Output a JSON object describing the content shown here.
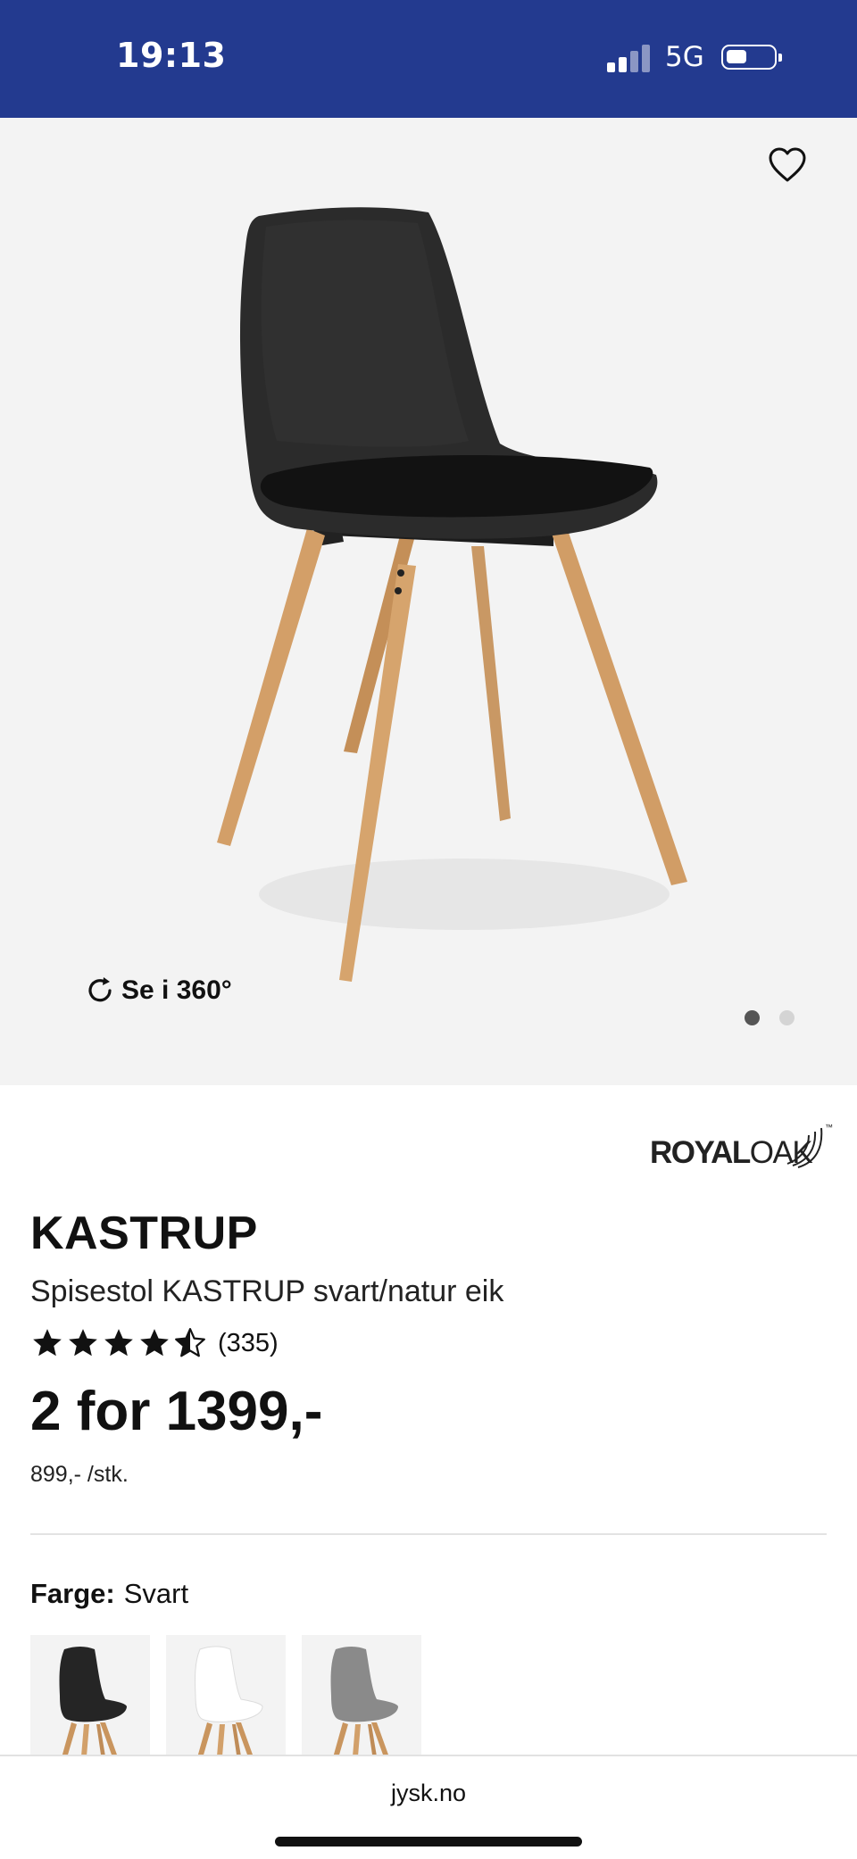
{
  "status_bar": {
    "time": "19:13",
    "network": "5G",
    "signal_bars": 2,
    "background_color": "#233a8f"
  },
  "hero": {
    "favorite_icon": "heart-outline-icon",
    "view_360_label": "Se i 360°",
    "view_360_icon": "rotate-icon",
    "carousel_pages": 2,
    "carousel_active": 1
  },
  "brand": {
    "name_bold": "ROYAL",
    "name_light": "OAK",
    "trademark": "™"
  },
  "product": {
    "name": "KASTRUP",
    "description": "Spisestol KASTRUP svart/natur eik",
    "rating": 4.5,
    "rating_count": "(335)",
    "price_main": "2 for 1399,-",
    "price_unit": "899,- /stk."
  },
  "color_selector": {
    "label": "Farge:",
    "selected": "Svart",
    "options": [
      {
        "name": "Svart",
        "color": "#2a2a2a"
      },
      {
        "name": "Hvit",
        "color": "#f8f8f8"
      },
      {
        "name": "Grå",
        "color": "#8a8a8a"
      }
    ]
  },
  "browser": {
    "url": "jysk.no"
  }
}
